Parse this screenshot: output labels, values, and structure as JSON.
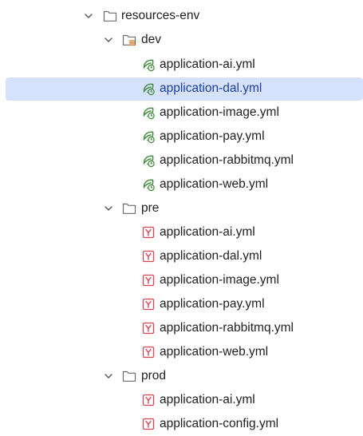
{
  "tree": {
    "root": {
      "label": "resources-env",
      "expanded": true
    },
    "dev": {
      "label": "dev",
      "expanded": true,
      "files": [
        {
          "label": "application-ai.yml",
          "icon": "spring-config-icon"
        },
        {
          "label": "application-dal.yml",
          "icon": "spring-config-icon",
          "selected": true
        },
        {
          "label": "application-image.yml",
          "icon": "spring-config-icon"
        },
        {
          "label": "application-pay.yml",
          "icon": "spring-config-icon"
        },
        {
          "label": "application-rabbitmq.yml",
          "icon": "spring-config-icon"
        },
        {
          "label": "application-web.yml",
          "icon": "spring-config-icon"
        }
      ]
    },
    "pre": {
      "label": "pre",
      "expanded": true,
      "files": [
        {
          "label": "application-ai.yml",
          "icon": "yaml-file-icon"
        },
        {
          "label": "application-dal.yml",
          "icon": "yaml-file-icon"
        },
        {
          "label": "application-image.yml",
          "icon": "yaml-file-icon"
        },
        {
          "label": "application-pay.yml",
          "icon": "yaml-file-icon"
        },
        {
          "label": "application-rabbitmq.yml",
          "icon": "yaml-file-icon"
        },
        {
          "label": "application-web.yml",
          "icon": "yaml-file-icon"
        }
      ]
    },
    "prod": {
      "label": "prod",
      "expanded": true,
      "files": [
        {
          "label": "application-ai.yml",
          "icon": "yaml-file-icon"
        },
        {
          "label": "application-config.yml",
          "icon": "yaml-file-icon"
        }
      ]
    }
  },
  "colors": {
    "selection": "#d6e2fb",
    "selected_text": "#1b3ea8",
    "spring_green": "#3f8a3a",
    "yaml_red": "#d94452",
    "folder_outline": "#6b6b6b",
    "resources_marker": "#e07a1f"
  }
}
